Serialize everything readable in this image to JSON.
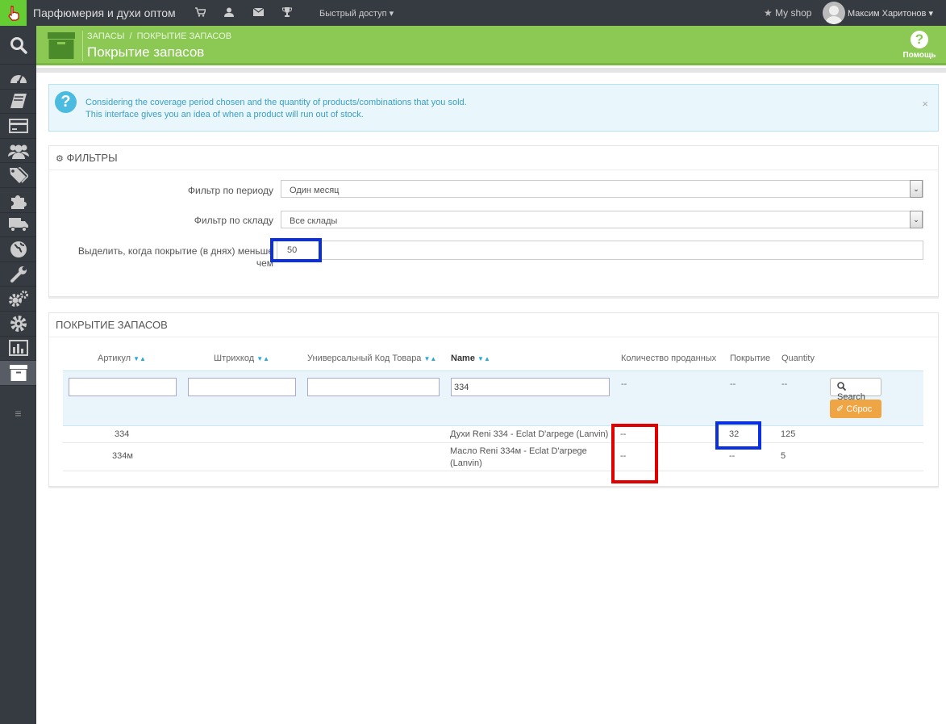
{
  "topbar": {
    "shop_title": "Парфюмерия и духи оптом",
    "quick_access": "Быстрый доступ",
    "my_shop": "My shop",
    "user_name": "Максим Харитонов"
  },
  "header": {
    "breadcrumb": [
      "ЗАПАСЫ",
      "ПОКРЫТИЕ ЗАПАСОВ"
    ],
    "title": "Покрытие запасов",
    "help_label": "Помощь"
  },
  "info": {
    "line1": "Considering the coverage period chosen and the quantity of products/combinations that you sold.",
    "line2": "This interface gives you an idea of when a product will run out of stock.",
    "close": "×"
  },
  "filters": {
    "heading": "ФИЛЬТРЫ",
    "period_label": "Фильтр по периоду",
    "period_value": "Один месяц",
    "warehouse_label": "Фильтр по складу",
    "warehouse_value": "Все склады",
    "highlight_label_1": "Выделить, когда покрытие (в днях) меньше",
    "highlight_label_2": "чем",
    "highlight_value": "50"
  },
  "coverage": {
    "heading": "ПОКРЫТИЕ ЗАПАСОВ",
    "columns": [
      "Артикул",
      "Штрихкод",
      "Универсальный Код Товара",
      "Name",
      "Количество проданных",
      "Покрытие",
      "Quantity"
    ],
    "filter_values": {
      "reference": "",
      "ean": "",
      "upc": "",
      "name": "334"
    },
    "filter_dashes": [
      "--",
      "--",
      "--"
    ],
    "search_label": "Search",
    "reset_label": "Сброс",
    "rows": [
      {
        "reference": "334",
        "name": "Духи Reni 334 - Eclat D'arpege (Lanvin)",
        "sold": "--",
        "coverage": "32",
        "quantity": "125"
      },
      {
        "reference": "334м",
        "name_line1": "Масло Reni 334м - Eclat D'arpege",
        "name_line2": "(Lanvin)",
        "sold": "--",
        "coverage": "--",
        "quantity": "5"
      }
    ]
  },
  "colors": {
    "accent_green": "#8bc954",
    "sidebar": "#363a41",
    "info_bg": "#e9f6fb",
    "reset_orange": "#f0a545"
  }
}
